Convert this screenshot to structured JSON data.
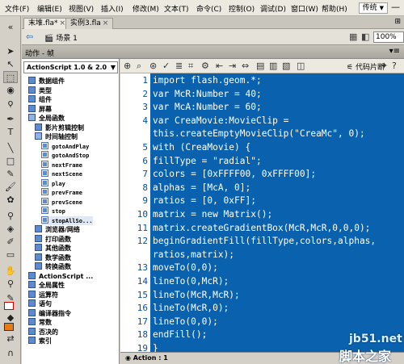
{
  "menu": {
    "items": [
      "文件(F)",
      "编辑(E)",
      "视图(V)",
      "插入(I)",
      "修改(M)",
      "文本(T)",
      "命令(C)",
      "控制(O)",
      "调试(D)",
      "窗口(W)",
      "帮助(H)"
    ],
    "workspace": "传统",
    "dash": "—"
  },
  "doc_tabs": [
    {
      "label": "末堆.fla*",
      "close": "×"
    },
    {
      "label": "实例3.fla",
      "close": "×"
    }
  ],
  "scene": {
    "label": "场景 1",
    "zoom": "100%"
  },
  "actions_panel": {
    "title": "动作 - 帧",
    "options": "▾≡"
  },
  "toolbox": {
    "version": "ActionScript 1.0 & 2.0",
    "items": [
      {
        "label": "数据组件",
        "kind": "book"
      },
      {
        "label": "类型",
        "kind": "book"
      },
      {
        "label": "组件",
        "kind": "book"
      },
      {
        "label": "屏幕",
        "kind": "book"
      },
      {
        "label": "全局函数",
        "kind": "open"
      },
      {
        "label": "影片剪辑控制",
        "kind": "book"
      },
      {
        "label": "时间轴控制",
        "kind": "open"
      },
      {
        "label": "gotoAndPlay",
        "kind": "fn"
      },
      {
        "label": "gotoAndStop",
        "kind": "fn"
      },
      {
        "label": "nextFrame",
        "kind": "fn"
      },
      {
        "label": "nextScene",
        "kind": "fn"
      },
      {
        "label": "play",
        "kind": "fn"
      },
      {
        "label": "prevFrame",
        "kind": "fn"
      },
      {
        "label": "prevScene",
        "kind": "fn"
      },
      {
        "label": "stop",
        "kind": "fn"
      },
      {
        "label": "stopAllSo...",
        "kind": "fn"
      },
      {
        "label": "浏览器/网络",
        "kind": "book"
      },
      {
        "label": "打印函数",
        "kind": "book"
      },
      {
        "label": "其他函数",
        "kind": "book"
      },
      {
        "label": "数学函数",
        "kind": "book"
      },
      {
        "label": "转换函数",
        "kind": "book"
      },
      {
        "label": "ActionScript ...",
        "kind": "book"
      },
      {
        "label": "全局属性",
        "kind": "book"
      },
      {
        "label": "运算符",
        "kind": "book"
      },
      {
        "label": "语句",
        "kind": "book"
      },
      {
        "label": "编译器指令",
        "kind": "book"
      },
      {
        "label": "常数",
        "kind": "book"
      },
      {
        "label": "否决的",
        "kind": "book"
      },
      {
        "label": "索引",
        "kind": "book"
      }
    ]
  },
  "code_toolbar": {
    "snippets": "代码片断"
  },
  "code": {
    "lines": [
      {
        "n": "1",
        "text": "import flash.geom.*;"
      },
      {
        "n": "2",
        "text": "var McR:Number = 40;"
      },
      {
        "n": "3",
        "text": "var McA:Number = 60;"
      },
      {
        "n": "4",
        "text": "var CreaMovie:MovieClip ="
      },
      {
        "n": "",
        "text": "this.createEmptyMovieClip(\"CreaMc\", 0);"
      },
      {
        "n": "5",
        "text": "with (CreaMovie) {"
      },
      {
        "n": "6",
        "text": "fillType = \"radial\";"
      },
      {
        "n": "7",
        "text": "colors = [0xFFFF00, 0xFFFF00];"
      },
      {
        "n": "8",
        "text": "alphas = [McA, 0];"
      },
      {
        "n": "9",
        "text": "ratios = [0, 0xFF];"
      },
      {
        "n": "10",
        "text": "matrix = new Matrix();"
      },
      {
        "n": "11",
        "text": "matrix.createGradientBox(McR,McR,0,0,0);"
      },
      {
        "n": "12",
        "text": "beginGradientFill(fillType,colors,alphas,"
      },
      {
        "n": "",
        "text": "ratios,matrix);"
      },
      {
        "n": "13",
        "text": "moveTo(0,0);"
      },
      {
        "n": "14",
        "text": "lineTo(0,McR);"
      },
      {
        "n": "15",
        "text": "lineTo(McR,McR);"
      },
      {
        "n": "16",
        "text": "lineTo(McR,0);"
      },
      {
        "n": "17",
        "text": "lineTo(0,0);"
      },
      {
        "n": "18",
        "text": "endFill();"
      },
      {
        "n": "19",
        "text": "}"
      }
    ]
  },
  "script_tab": {
    "label": "Action : 1"
  },
  "watermark": {
    "line1": "jb51.net",
    "line2": "脚本之家"
  },
  "colors": {
    "code_bg": "#0a62ae",
    "code_text": "#ffffff",
    "line_number": "#0650a8"
  }
}
